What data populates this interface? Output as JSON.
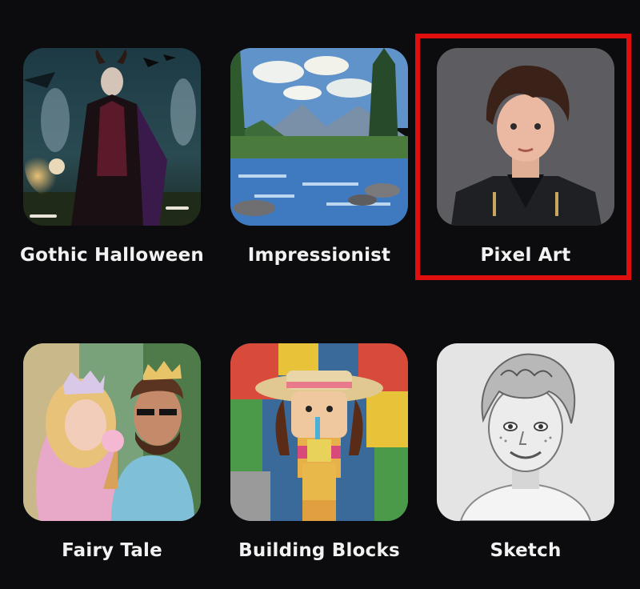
{
  "styles": [
    {
      "id": "gothic-halloween",
      "label": "Gothic Halloween"
    },
    {
      "id": "impressionist",
      "label": "Impressionist"
    },
    {
      "id": "pixel-art",
      "label": "Pixel Art"
    },
    {
      "id": "fairy-tale",
      "label": "Fairy Tale"
    },
    {
      "id": "building-blocks",
      "label": "Building Blocks"
    },
    {
      "id": "sketch",
      "label": "Sketch"
    }
  ],
  "selected_style": "pixel-art",
  "colors": {
    "background": "#0c0c0e",
    "selection_border": "#e10e0e",
    "label_text": "#f2f2f2"
  }
}
